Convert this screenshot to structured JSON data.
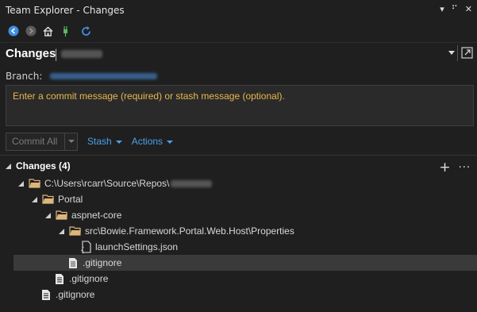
{
  "window": {
    "title": "Team Explorer - Changes"
  },
  "toolbar": {
    "buttons": [
      "back-icon",
      "forward-icon",
      "home-icon",
      "connect-icon",
      "refresh-icon"
    ]
  },
  "header": {
    "title": "Changes",
    "separator": "|"
  },
  "branch": {
    "label": "Branch:"
  },
  "commit_message": {
    "placeholder": "Enter a commit message (required) or stash message (optional)."
  },
  "actions": {
    "commit_all": "Commit All",
    "stash": "Stash",
    "actions": "Actions"
  },
  "changes": {
    "section_title": "Changes (4)",
    "tree": [
      {
        "label": "C:\\Users\\rcarr\\Source\\Repos\\",
        "type": "folder",
        "level": 0
      },
      {
        "label": "Portal",
        "type": "folder",
        "level": 1
      },
      {
        "label": "aspnet-core",
        "type": "folder",
        "level": 2
      },
      {
        "label": "src\\Bowie.Framework.Portal.Web.Host\\Properties",
        "type": "folder",
        "level": 3
      },
      {
        "label": "launchSettings.json",
        "type": "json-file",
        "level": 4
      },
      {
        "label": ".gitignore",
        "type": "file",
        "level": 3,
        "selected": true
      },
      {
        "label": ".gitignore",
        "type": "file",
        "level": 2
      },
      {
        "label": ".gitignore",
        "type": "file",
        "level": 1
      }
    ]
  },
  "colors": {
    "accent_blue": "#4aa0ea",
    "placeholder_amber": "#e7b84e",
    "folder_orange": "#dcb67a"
  }
}
